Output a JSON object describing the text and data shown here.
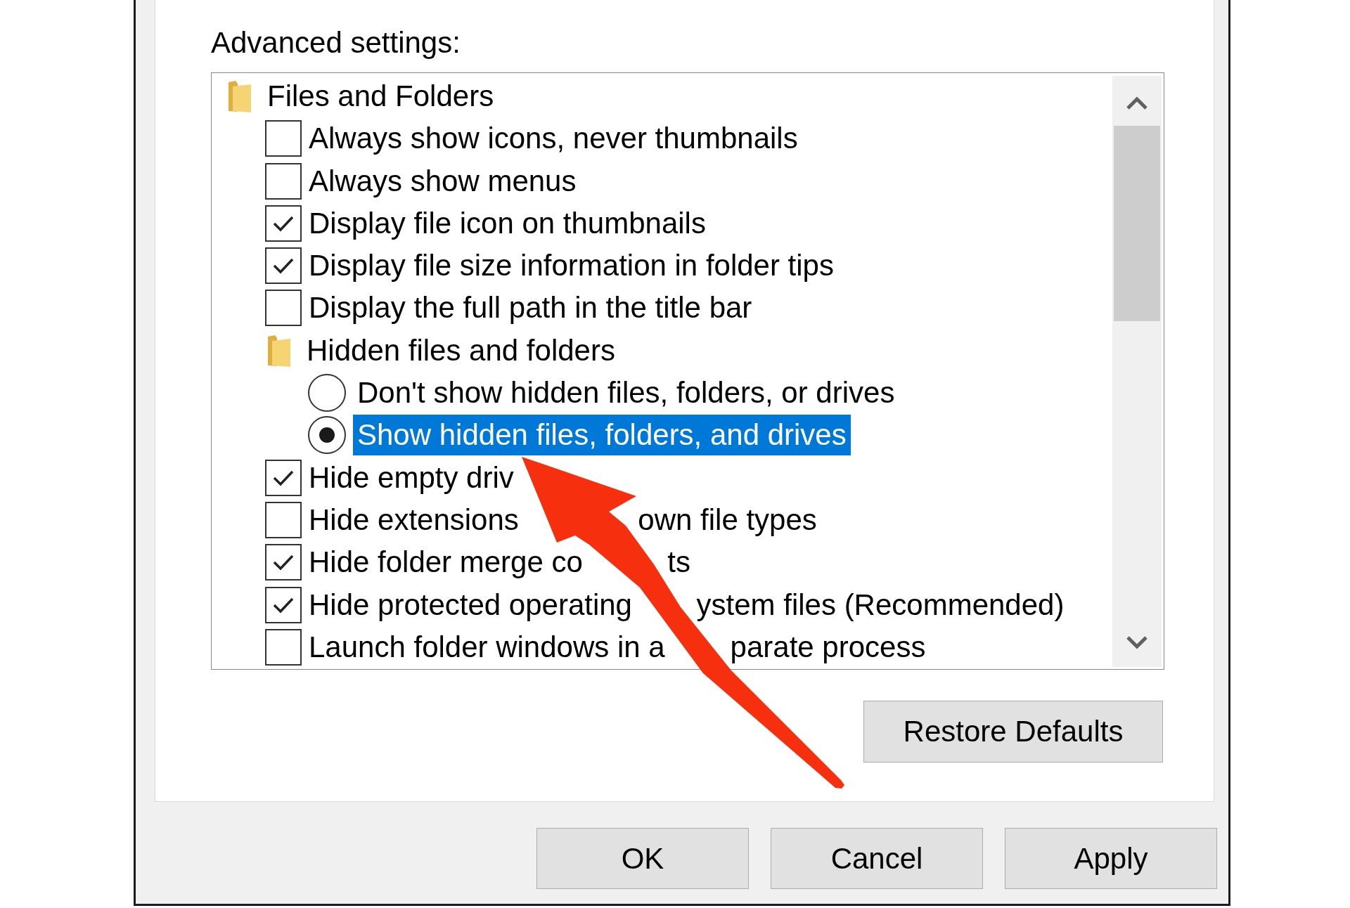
{
  "settings_panel": {
    "label": "Advanced settings:",
    "tree": [
      {
        "kind": "folder",
        "label": "Files and Folders",
        "selected": false,
        "children": [
          {
            "kind": "checkbox",
            "label": "Always show icons, never thumbnails",
            "checked": false,
            "selected": false
          },
          {
            "kind": "checkbox",
            "label": "Always show menus",
            "checked": false,
            "selected": false
          },
          {
            "kind": "checkbox",
            "label": "Display file icon on thumbnails",
            "checked": true,
            "selected": false
          },
          {
            "kind": "checkbox",
            "label": "Display file size information in folder tips",
            "checked": true,
            "selected": false
          },
          {
            "kind": "checkbox",
            "label": "Display the full path in the title bar",
            "checked": false,
            "selected": false
          },
          {
            "kind": "folder",
            "label": "Hidden files and folders",
            "selected": false,
            "children": [
              {
                "kind": "radio",
                "label": "Don't show hidden files, folders, or drives",
                "checked": false,
                "selected": false
              },
              {
                "kind": "radio",
                "label": "Show hidden files, folders, and drives",
                "checked": true,
                "selected": true
              }
            ]
          },
          {
            "kind": "checkbox",
            "label": "Hide empty driv",
            "checked": true,
            "selected": false
          },
          {
            "kind": "checkbox",
            "label_parts": [
              "Hide extensions",
              "own file types"
            ],
            "checked": false,
            "selected": false
          },
          {
            "kind": "checkbox",
            "label_parts": [
              "Hide folder merge co",
              "ts"
            ],
            "checked": true,
            "selected": false
          },
          {
            "kind": "checkbox",
            "label_parts": [
              "Hide protected operating",
              "ystem files (Recommended)"
            ],
            "checked": true,
            "selected": false
          },
          {
            "kind": "checkbox",
            "label_parts": [
              "Launch folder windows in a",
              "parate process"
            ],
            "checked": false,
            "selected": false
          }
        ]
      }
    ],
    "restore_button": {
      "label": "Restore Defaults"
    }
  },
  "annotation": {
    "kind": "arrow"
  },
  "buttons": [
    {
      "label": "OK"
    },
    {
      "label": "Cancel"
    },
    {
      "label": "Apply"
    }
  ]
}
